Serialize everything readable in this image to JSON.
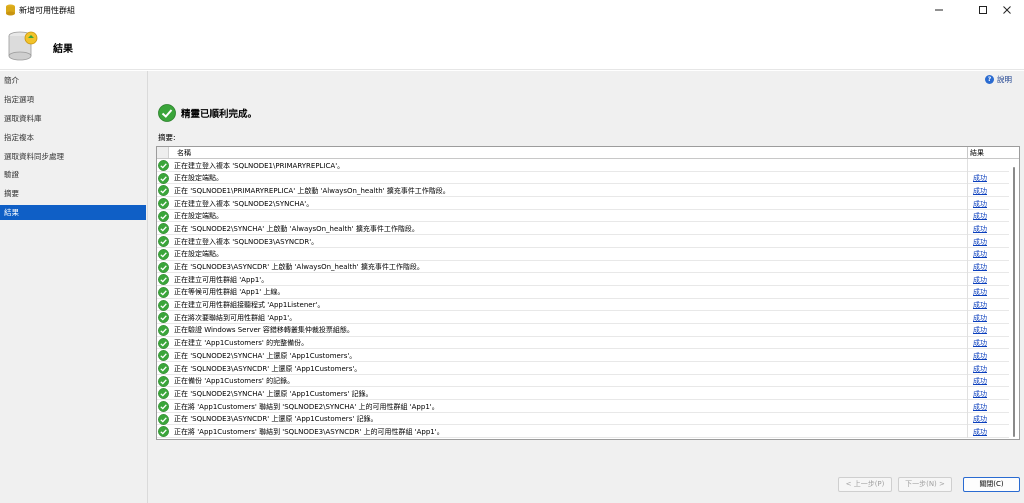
{
  "window": {
    "title": "新增可用性群組"
  },
  "header": {
    "title": "結果"
  },
  "sidebar": {
    "items": [
      {
        "label": "簡介",
        "active": false
      },
      {
        "label": "指定選項",
        "active": false
      },
      {
        "label": "選取資料庫",
        "active": false
      },
      {
        "label": "指定複本",
        "active": false
      },
      {
        "label": "選取資料同步處理",
        "active": false
      },
      {
        "label": "驗證",
        "active": false
      },
      {
        "label": "摘要",
        "active": false
      },
      {
        "label": "結果",
        "active": true
      }
    ]
  },
  "main": {
    "help_label": "說明",
    "success_text": "精靈已順利完成。",
    "summary_label": "摘要:",
    "columns": {
      "name": "名稱",
      "result": "結果"
    },
    "rows": [
      {
        "text": "正在建立登入複本 'SQLNODE1\\PRIMARYREPLICA'。",
        "result": ""
      },
      {
        "text": "正在設定端點。",
        "result": "成功"
      },
      {
        "text": "正在 'SQLNODE1\\PRIMARYREPLICA' 上啟動 'AlwaysOn_health' 擴充事件工作階段。",
        "result": "成功"
      },
      {
        "text": "正在建立登入複本 'SQLNODE2\\SYNCHA'。",
        "result": "成功"
      },
      {
        "text": "正在設定端點。",
        "result": "成功"
      },
      {
        "text": "正在 'SQLNODE2\\SYNCHA' 上啟動 'AlwaysOn_health' 擴充事件工作階段。",
        "result": "成功"
      },
      {
        "text": "正在建立登入複本 'SQLNODE3\\ASYNCDR'。",
        "result": "成功"
      },
      {
        "text": "正在設定端點。",
        "result": "成功"
      },
      {
        "text": "正在 'SQLNODE3\\ASYNCDR' 上啟動 'AlwaysOn_health' 擴充事件工作階段。",
        "result": "成功"
      },
      {
        "text": "正在建立可用性群組 'App1'。",
        "result": "成功"
      },
      {
        "text": "正在等候可用性群組 'App1' 上線。",
        "result": "成功"
      },
      {
        "text": "正在建立可用性群組接聽程式 'App1Listener'。",
        "result": "成功"
      },
      {
        "text": "正在將次要聯結到可用性群組 'App1'。",
        "result": "成功"
      },
      {
        "text": "正在驗證 Windows Server 容錯移轉叢集仲裁投票組態。",
        "result": "成功"
      },
      {
        "text": "正在建立 'App1Customers' 的完整備份。",
        "result": "成功"
      },
      {
        "text": "正在 'SQLNODE2\\SYNCHA' 上還原 'App1Customers'。",
        "result": "成功"
      },
      {
        "text": "正在 'SQLNODE3\\ASYNCDR' 上還原 'App1Customers'。",
        "result": "成功"
      },
      {
        "text": "正在備份 'App1Customers' 的記錄。",
        "result": "成功"
      },
      {
        "text": "正在 'SQLNODE2\\SYNCHA' 上還原 'App1Customers' 記錄。",
        "result": "成功"
      },
      {
        "text": "正在將 'App1Customers' 聯結到 'SQLNODE2\\SYNCHA' 上的可用性群組 'App1'。",
        "result": "成功"
      },
      {
        "text": "正在 'SQLNODE3\\ASYNCDR' 上還原 'App1Customers' 記錄。",
        "result": "成功"
      },
      {
        "text": "正在將 'App1Customers' 聯結到 'SQLNODE3\\ASYNCDR' 上的可用性群組 'App1'。",
        "result": "成功"
      }
    ]
  },
  "footer": {
    "prev_label": "< 上一步(P)",
    "next_label": "下一步(N) >",
    "close_label": "關閉(C)"
  },
  "colors": {
    "accent": "#0f5fc6",
    "success": "#3aa53a",
    "link": "#0b3fbd"
  },
  "icons": {
    "app": "database-wizard-icon",
    "status": "green-check-icon",
    "help": "help-icon"
  }
}
